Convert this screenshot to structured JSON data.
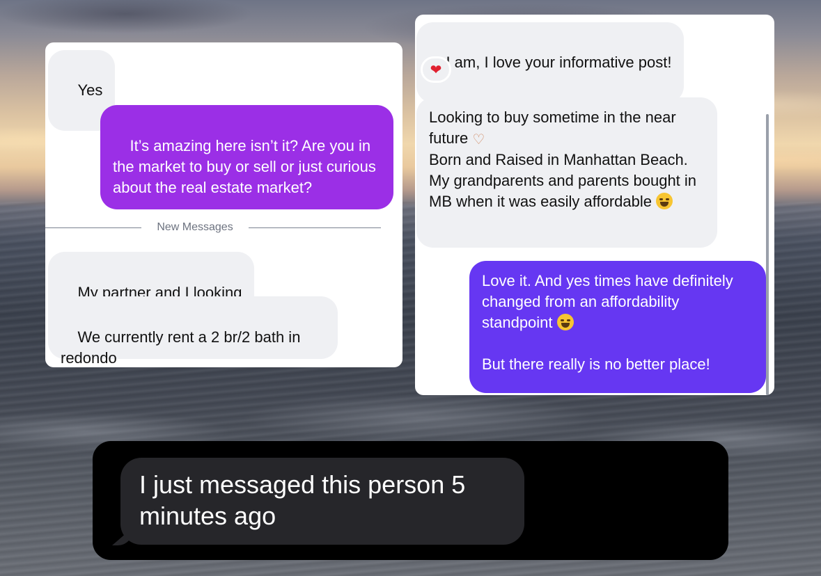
{
  "left_chat": {
    "messages": [
      {
        "id": "yes",
        "direction": "incoming",
        "text": "Yes"
      },
      {
        "id": "amazing",
        "direction": "outgoing",
        "text": "It’s amazing here isn’t it? Are you in the market to buy or sell or just curious about the real estate market?"
      },
      {
        "id": "partner",
        "direction": "incoming",
        "text": "My partner and I looking"
      },
      {
        "id": "rent",
        "direction": "incoming",
        "text": "We currently rent a 2 br/2 bath in redondo"
      }
    ],
    "divider_label": "New Messages"
  },
  "right_chat": {
    "messages": [
      {
        "id": "informative",
        "direction": "incoming",
        "text": "I am, I love your informative post!"
      },
      {
        "id": "looking",
        "direction": "incoming",
        "line1": "Looking to buy sometime in the near future",
        "line2": "Born and Raised in Manhattan Beach. My grandparents and parents bought in MB when it was easily affordable"
      },
      {
        "id": "loveit",
        "direction": "outgoing",
        "line1": "Love it. And yes times have definitely changed from an affordability standpoint",
        "line2": "But there really is no better place!"
      }
    ],
    "reaction": "heart-reaction-icon"
  },
  "overlay_message": {
    "text": "I just messaged this person 5 minutes ago"
  },
  "colors": {
    "outgoing_purple": "#9b2fe6",
    "outgoing_violet": "#6637f2",
    "incoming_gray": "#eff0f3",
    "dark_bubble": "#26262a"
  }
}
